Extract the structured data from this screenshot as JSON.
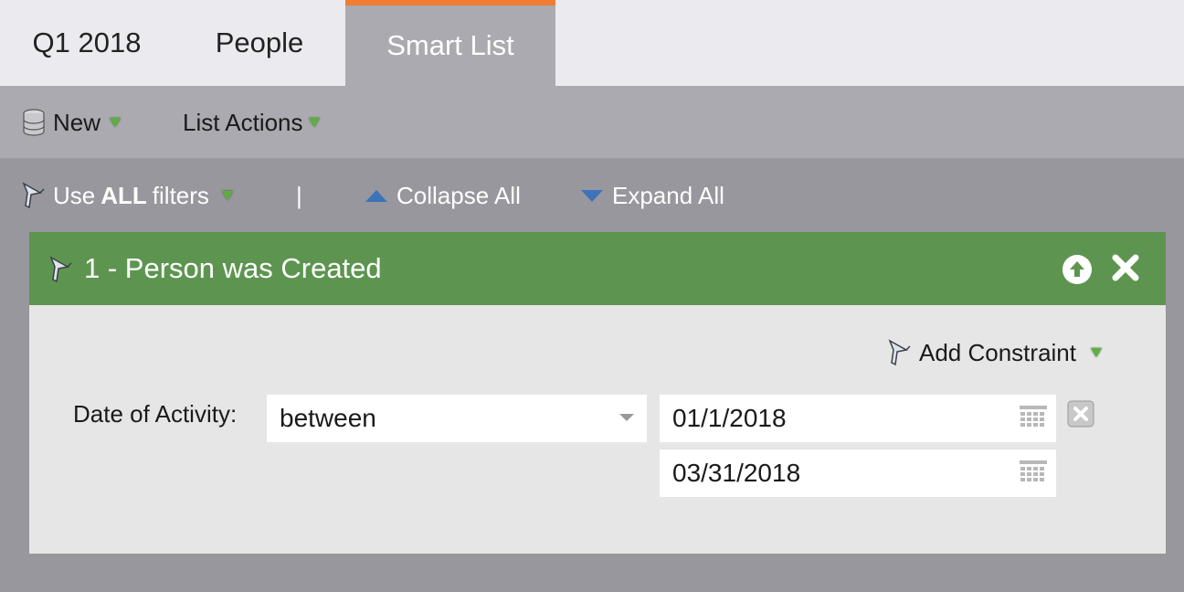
{
  "tabs": [
    {
      "label": "Q1 2018"
    },
    {
      "label": "People"
    },
    {
      "label": "Smart List"
    }
  ],
  "toolbar": {
    "new_label": "New",
    "new_icon": "database-icon",
    "list_actions_label": "List Actions"
  },
  "filterbar": {
    "use_prefix": "Use",
    "use_bold": "ALL",
    "use_suffix": "filters",
    "separator": "|",
    "collapse_label": "Collapse All",
    "expand_label": "Expand All"
  },
  "filter": {
    "title": "1 - Person was Created",
    "add_constraint_label": "Add Constraint",
    "field_label": "Date of Activity:",
    "operator_value": "between",
    "date_start": "01/1/2018",
    "date_end": "03/31/2018"
  },
  "colors": {
    "accent_tab_border": "#f07d32",
    "header_green": "#5d9550",
    "caret_green": "#5fae43",
    "triangle_blue": "#3d73b8"
  }
}
